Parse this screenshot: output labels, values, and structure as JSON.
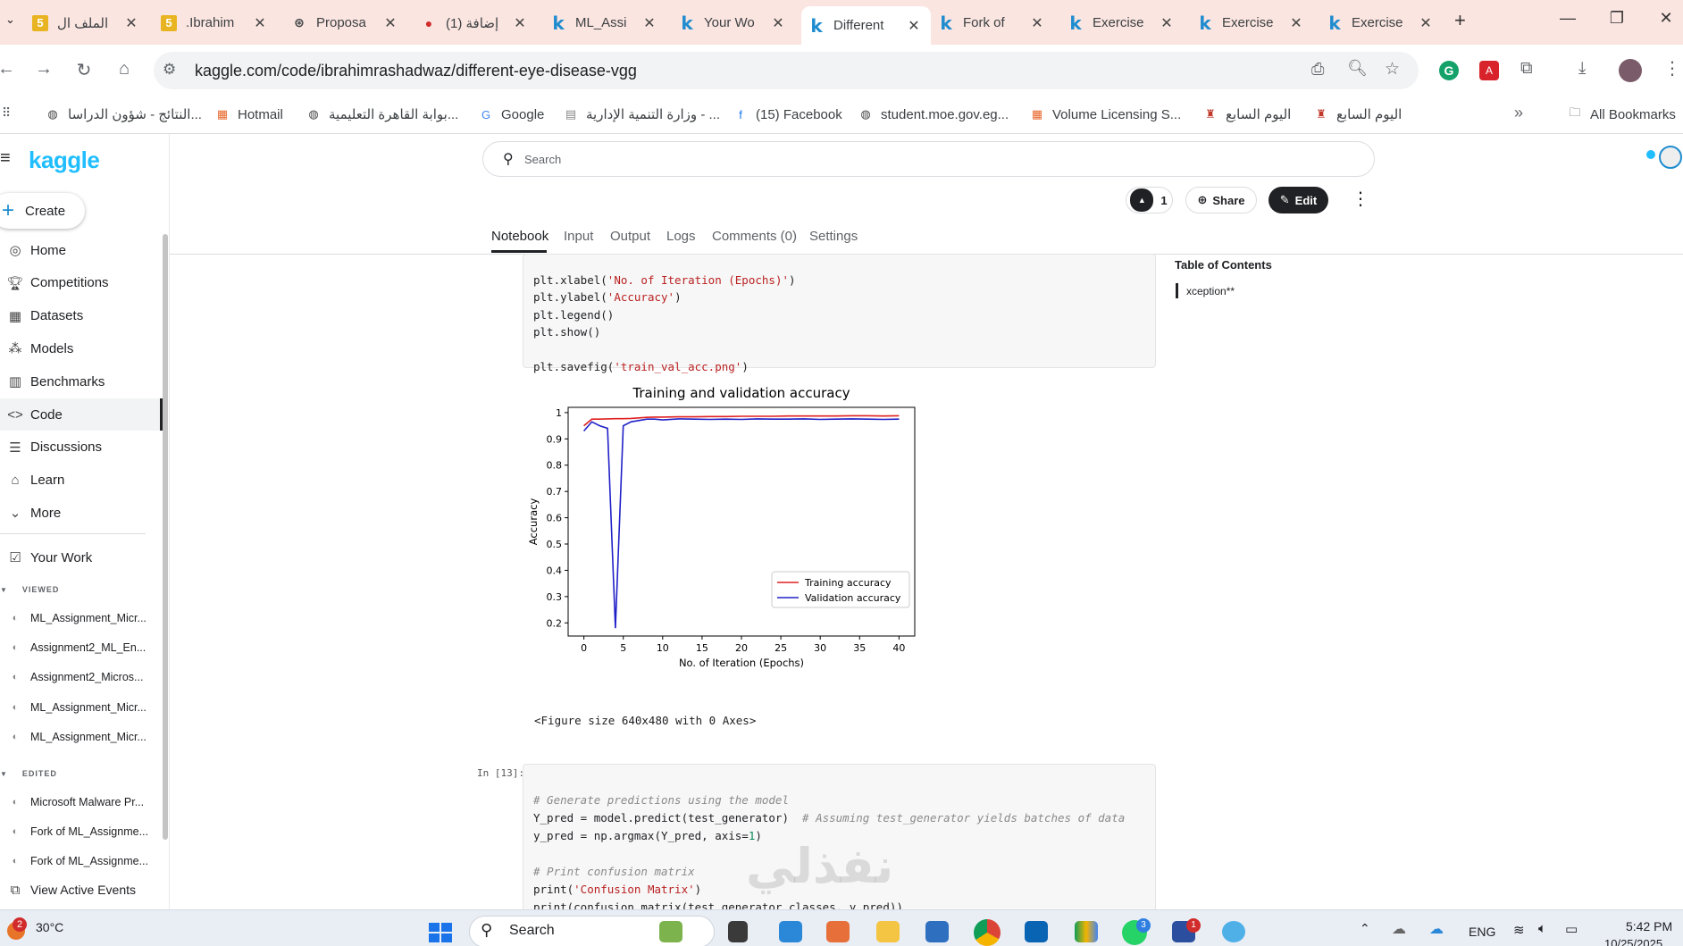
{
  "browser": {
    "tabs": [
      {
        "title": "الملف ال",
        "icon": "five-icon",
        "active": false
      },
      {
        "title": ".Ibrahim",
        "icon": "five-icon",
        "active": false
      },
      {
        "title": "Proposa",
        "icon": "openai-icon",
        "active": false
      },
      {
        "title": "(1) إضافة",
        "icon": "notification-icon",
        "active": false
      },
      {
        "title": "ML_Assi",
        "icon": "kaggle-icon",
        "active": false
      },
      {
        "title": "Your Wo",
        "icon": "kaggle-icon",
        "active": false
      },
      {
        "title": "Different",
        "icon": "kaggle-icon",
        "active": true
      },
      {
        "title": "Fork of",
        "icon": "kaggle-icon",
        "active": false
      },
      {
        "title": "Exercise",
        "icon": "kaggle-icon",
        "active": false
      },
      {
        "title": "Exercise",
        "icon": "kaggle-icon",
        "active": false
      },
      {
        "title": "Exercise",
        "icon": "kaggle-icon",
        "active": false
      }
    ],
    "url": "kaggle.com/code/ibrahimrashadwaz/different-eye-disease-vgg",
    "bookmarks": [
      {
        "label": "النتائج - شؤون الدراسا...",
        "icon": "globe-icon"
      },
      {
        "label": "Hotmail",
        "icon": "microsoft-icon"
      },
      {
        "label": "بوابة القاهرة التعليمية...",
        "icon": "globe-icon"
      },
      {
        "label": "Google",
        "icon": "google-icon"
      },
      {
        "label": "وزارة التنمية الإدارية - ...",
        "icon": "page-icon"
      },
      {
        "label": "(15) Facebook",
        "icon": "facebook-icon"
      },
      {
        "label": "student.moe.gov.eg...",
        "icon": "globe-icon"
      },
      {
        "label": "Volume Licensing S...",
        "icon": "microsoft-icon"
      },
      {
        "label": "اليوم السابع",
        "icon": "news-icon"
      },
      {
        "label": "اليوم السابع",
        "icon": "news-icon"
      }
    ],
    "all_bookmarks": "All Bookmarks"
  },
  "kaggle": {
    "logo": "kaggle",
    "create": "Create",
    "nav": [
      {
        "label": "Home",
        "icon": "compass-icon"
      },
      {
        "label": "Competitions",
        "icon": "trophy-icon"
      },
      {
        "label": "Datasets",
        "icon": "table-icon"
      },
      {
        "label": "Models",
        "icon": "models-icon"
      },
      {
        "label": "Benchmarks",
        "icon": "bar-chart-icon"
      },
      {
        "label": "Code",
        "icon": "code-icon",
        "active": true
      },
      {
        "label": "Discussions",
        "icon": "comments-icon"
      },
      {
        "label": "Learn",
        "icon": "school-icon"
      },
      {
        "label": "More",
        "icon": "chevron-down-icon"
      }
    ],
    "your_work": "Your Work",
    "viewed_label": "VIEWED",
    "viewed": [
      "ML_Assignment_Micr...",
      "Assignment2_ML_En...",
      "Assignment2_Micros...",
      "ML_Assignment_Micr...",
      "ML_Assignment_Micr..."
    ],
    "edited_label": "EDITED",
    "edited": [
      "Microsoft Malware Pr...",
      "Fork of ML_Assignme...",
      "Fork of ML_Assignme..."
    ],
    "view_active_events": "View Active Events",
    "search_placeholder": "Search",
    "vote_count": "1",
    "share": "Share",
    "edit": "Edit",
    "tabs": [
      "Notebook",
      "Input",
      "Output",
      "Logs",
      "Comments (0)",
      "Settings"
    ],
    "toc_title": "Table of Contents",
    "toc_items": [
      "xception**"
    ]
  },
  "cell1": {
    "l1a": "plt.xlabel(",
    "l1s": "'No. of Iteration (Epochs)'",
    "l1b": ")",
    "l2a": "plt.ylabel(",
    "l2s": "'Accuracy'",
    "l2b": ")",
    "l3": "plt.legend()",
    "l4": "plt.show()",
    "l5a": "plt.savefig(",
    "l5s": "'train_val_acc.png'",
    "l5b": ")"
  },
  "figure_output": "<Figure size 640x480 with 0 Axes>",
  "cell2": {
    "prompt": "In [13]:",
    "c1": "# Generate predictions using the model",
    "l2": "Y_pred = model.predict(test_generator)  ",
    "c2": "# Assuming test_generator yields batches of data",
    "l3a": "y_pred = np.argmax(Y_pred, axis=",
    "l3n": "1",
    "l3b": ")",
    "c4": "# Print confusion matrix",
    "l5a": "print(",
    "l5s": "'Confusion Matrix'",
    "l5b": ")",
    "l6": "print(confusion_matrix(test_generator.classes, y_pred))"
  },
  "chart_data": {
    "type": "line",
    "title": "Training and validation accuracy",
    "xlabel": "No. of Iteration (Epochs)",
    "ylabel": "Accuracy",
    "xlim": [
      -2,
      42
    ],
    "ylim": [
      0.15,
      1.02
    ],
    "xticks": [
      0,
      5,
      10,
      15,
      20,
      25,
      30,
      35,
      40
    ],
    "yticks": [
      0.2,
      0.3,
      0.4,
      0.5,
      0.6,
      0.7,
      0.8,
      0.9,
      1.0
    ],
    "legend_position": "lower-right",
    "grid": false,
    "series": [
      {
        "name": "Training accuracy",
        "color": "#e02020",
        "x": [
          0,
          1,
          2,
          3,
          4,
          5,
          6,
          7,
          8,
          9,
          10,
          12,
          14,
          16,
          18,
          20,
          22,
          24,
          26,
          28,
          30,
          32,
          34,
          36,
          38,
          40
        ],
        "y": [
          0.95,
          0.975,
          0.975,
          0.976,
          0.977,
          0.977,
          0.978,
          0.98,
          0.982,
          0.983,
          0.983,
          0.984,
          0.984,
          0.985,
          0.985,
          0.986,
          0.986,
          0.986,
          0.987,
          0.987,
          0.987,
          0.987,
          0.988,
          0.988,
          0.987,
          0.988
        ]
      },
      {
        "name": "Validation accuracy",
        "color": "#2020c8",
        "x": [
          0,
          1,
          2,
          3,
          4,
          5,
          6,
          7,
          8,
          9,
          10,
          12,
          14,
          16,
          18,
          20,
          22,
          24,
          26,
          28,
          30,
          32,
          34,
          36,
          38,
          40
        ],
        "y": [
          0.93,
          0.965,
          0.95,
          0.94,
          0.18,
          0.95,
          0.965,
          0.97,
          0.975,
          0.975,
          0.972,
          0.976,
          0.975,
          0.974,
          0.975,
          0.974,
          0.976,
          0.975,
          0.975,
          0.976,
          0.974,
          0.975,
          0.976,
          0.975,
          0.974,
          0.975
        ]
      }
    ]
  },
  "taskbar": {
    "temperature": "30°C",
    "weather_badge": "2",
    "search": "Search",
    "lang": "ENG",
    "time": "5:42 PM",
    "date": "10/25/2025",
    "badge_whatsapp": "3",
    "badge_app": "1"
  },
  "watermark": "نفذلي"
}
